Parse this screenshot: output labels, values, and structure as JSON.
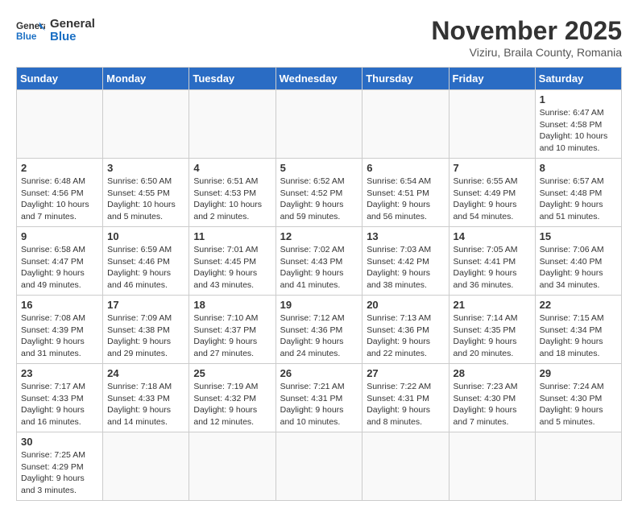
{
  "header": {
    "logo_general": "General",
    "logo_blue": "Blue",
    "month_title": "November 2025",
    "subtitle": "Viziru, Braila County, Romania"
  },
  "days_of_week": [
    "Sunday",
    "Monday",
    "Tuesday",
    "Wednesday",
    "Thursday",
    "Friday",
    "Saturday"
  ],
  "weeks": [
    [
      {
        "day": "",
        "info": ""
      },
      {
        "day": "",
        "info": ""
      },
      {
        "day": "",
        "info": ""
      },
      {
        "day": "",
        "info": ""
      },
      {
        "day": "",
        "info": ""
      },
      {
        "day": "",
        "info": ""
      },
      {
        "day": "1",
        "info": "Sunrise: 6:47 AM\nSunset: 4:58 PM\nDaylight: 10 hours and 10 minutes."
      }
    ],
    [
      {
        "day": "2",
        "info": "Sunrise: 6:48 AM\nSunset: 4:56 PM\nDaylight: 10 hours and 7 minutes."
      },
      {
        "day": "3",
        "info": "Sunrise: 6:50 AM\nSunset: 4:55 PM\nDaylight: 10 hours and 5 minutes."
      },
      {
        "day": "4",
        "info": "Sunrise: 6:51 AM\nSunset: 4:53 PM\nDaylight: 10 hours and 2 minutes."
      },
      {
        "day": "5",
        "info": "Sunrise: 6:52 AM\nSunset: 4:52 PM\nDaylight: 9 hours and 59 minutes."
      },
      {
        "day": "6",
        "info": "Sunrise: 6:54 AM\nSunset: 4:51 PM\nDaylight: 9 hours and 56 minutes."
      },
      {
        "day": "7",
        "info": "Sunrise: 6:55 AM\nSunset: 4:49 PM\nDaylight: 9 hours and 54 minutes."
      },
      {
        "day": "8",
        "info": "Sunrise: 6:57 AM\nSunset: 4:48 PM\nDaylight: 9 hours and 51 minutes."
      }
    ],
    [
      {
        "day": "9",
        "info": "Sunrise: 6:58 AM\nSunset: 4:47 PM\nDaylight: 9 hours and 49 minutes."
      },
      {
        "day": "10",
        "info": "Sunrise: 6:59 AM\nSunset: 4:46 PM\nDaylight: 9 hours and 46 minutes."
      },
      {
        "day": "11",
        "info": "Sunrise: 7:01 AM\nSunset: 4:45 PM\nDaylight: 9 hours and 43 minutes."
      },
      {
        "day": "12",
        "info": "Sunrise: 7:02 AM\nSunset: 4:43 PM\nDaylight: 9 hours and 41 minutes."
      },
      {
        "day": "13",
        "info": "Sunrise: 7:03 AM\nSunset: 4:42 PM\nDaylight: 9 hours and 38 minutes."
      },
      {
        "day": "14",
        "info": "Sunrise: 7:05 AM\nSunset: 4:41 PM\nDaylight: 9 hours and 36 minutes."
      },
      {
        "day": "15",
        "info": "Sunrise: 7:06 AM\nSunset: 4:40 PM\nDaylight: 9 hours and 34 minutes."
      }
    ],
    [
      {
        "day": "16",
        "info": "Sunrise: 7:08 AM\nSunset: 4:39 PM\nDaylight: 9 hours and 31 minutes."
      },
      {
        "day": "17",
        "info": "Sunrise: 7:09 AM\nSunset: 4:38 PM\nDaylight: 9 hours and 29 minutes."
      },
      {
        "day": "18",
        "info": "Sunrise: 7:10 AM\nSunset: 4:37 PM\nDaylight: 9 hours and 27 minutes."
      },
      {
        "day": "19",
        "info": "Sunrise: 7:12 AM\nSunset: 4:36 PM\nDaylight: 9 hours and 24 minutes."
      },
      {
        "day": "20",
        "info": "Sunrise: 7:13 AM\nSunset: 4:36 PM\nDaylight: 9 hours and 22 minutes."
      },
      {
        "day": "21",
        "info": "Sunrise: 7:14 AM\nSunset: 4:35 PM\nDaylight: 9 hours and 20 minutes."
      },
      {
        "day": "22",
        "info": "Sunrise: 7:15 AM\nSunset: 4:34 PM\nDaylight: 9 hours and 18 minutes."
      }
    ],
    [
      {
        "day": "23",
        "info": "Sunrise: 7:17 AM\nSunset: 4:33 PM\nDaylight: 9 hours and 16 minutes."
      },
      {
        "day": "24",
        "info": "Sunrise: 7:18 AM\nSunset: 4:33 PM\nDaylight: 9 hours and 14 minutes."
      },
      {
        "day": "25",
        "info": "Sunrise: 7:19 AM\nSunset: 4:32 PM\nDaylight: 9 hours and 12 minutes."
      },
      {
        "day": "26",
        "info": "Sunrise: 7:21 AM\nSunset: 4:31 PM\nDaylight: 9 hours and 10 minutes."
      },
      {
        "day": "27",
        "info": "Sunrise: 7:22 AM\nSunset: 4:31 PM\nDaylight: 9 hours and 8 minutes."
      },
      {
        "day": "28",
        "info": "Sunrise: 7:23 AM\nSunset: 4:30 PM\nDaylight: 9 hours and 7 minutes."
      },
      {
        "day": "29",
        "info": "Sunrise: 7:24 AM\nSunset: 4:30 PM\nDaylight: 9 hours and 5 minutes."
      }
    ],
    [
      {
        "day": "30",
        "info": "Sunrise: 7:25 AM\nSunset: 4:29 PM\nDaylight: 9 hours and 3 minutes."
      },
      {
        "day": "",
        "info": ""
      },
      {
        "day": "",
        "info": ""
      },
      {
        "day": "",
        "info": ""
      },
      {
        "day": "",
        "info": ""
      },
      {
        "day": "",
        "info": ""
      },
      {
        "day": "",
        "info": ""
      }
    ]
  ]
}
